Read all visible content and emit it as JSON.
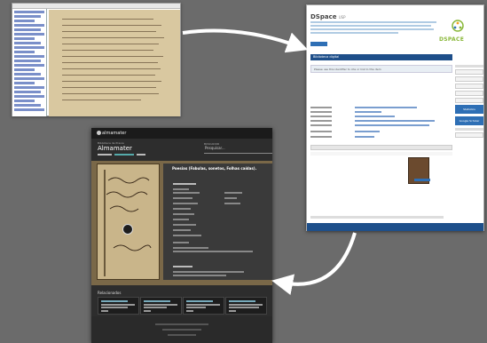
{
  "dspace": {
    "brand_title": "DSpace",
    "brand_suffix": "USP",
    "logo_word": "DSPACE",
    "nav_label": "Biblioteca digital",
    "alert_text": "Please use this identifier to cite or link to this item",
    "side_button_1": "Statistics",
    "side_button_2": "Google Scholar"
  },
  "almamater": {
    "app_name": "almamater",
    "institution": "Biblioteca de Pravia",
    "heading": "Almamater",
    "search_label": "BUSCADOR",
    "search_placeholder": "Pesquisar...",
    "doc_title": "Poesias (Fabulas, sonetos, Folhas caídas).",
    "related_title": "Relacionados"
  },
  "colors": {
    "background": "#6b6b6b",
    "arrow": "#ffffff",
    "dspace_blue": "#1e4f8a",
    "dspace_green": "#8ab83a",
    "alma_dark": "#2d2d2d"
  }
}
